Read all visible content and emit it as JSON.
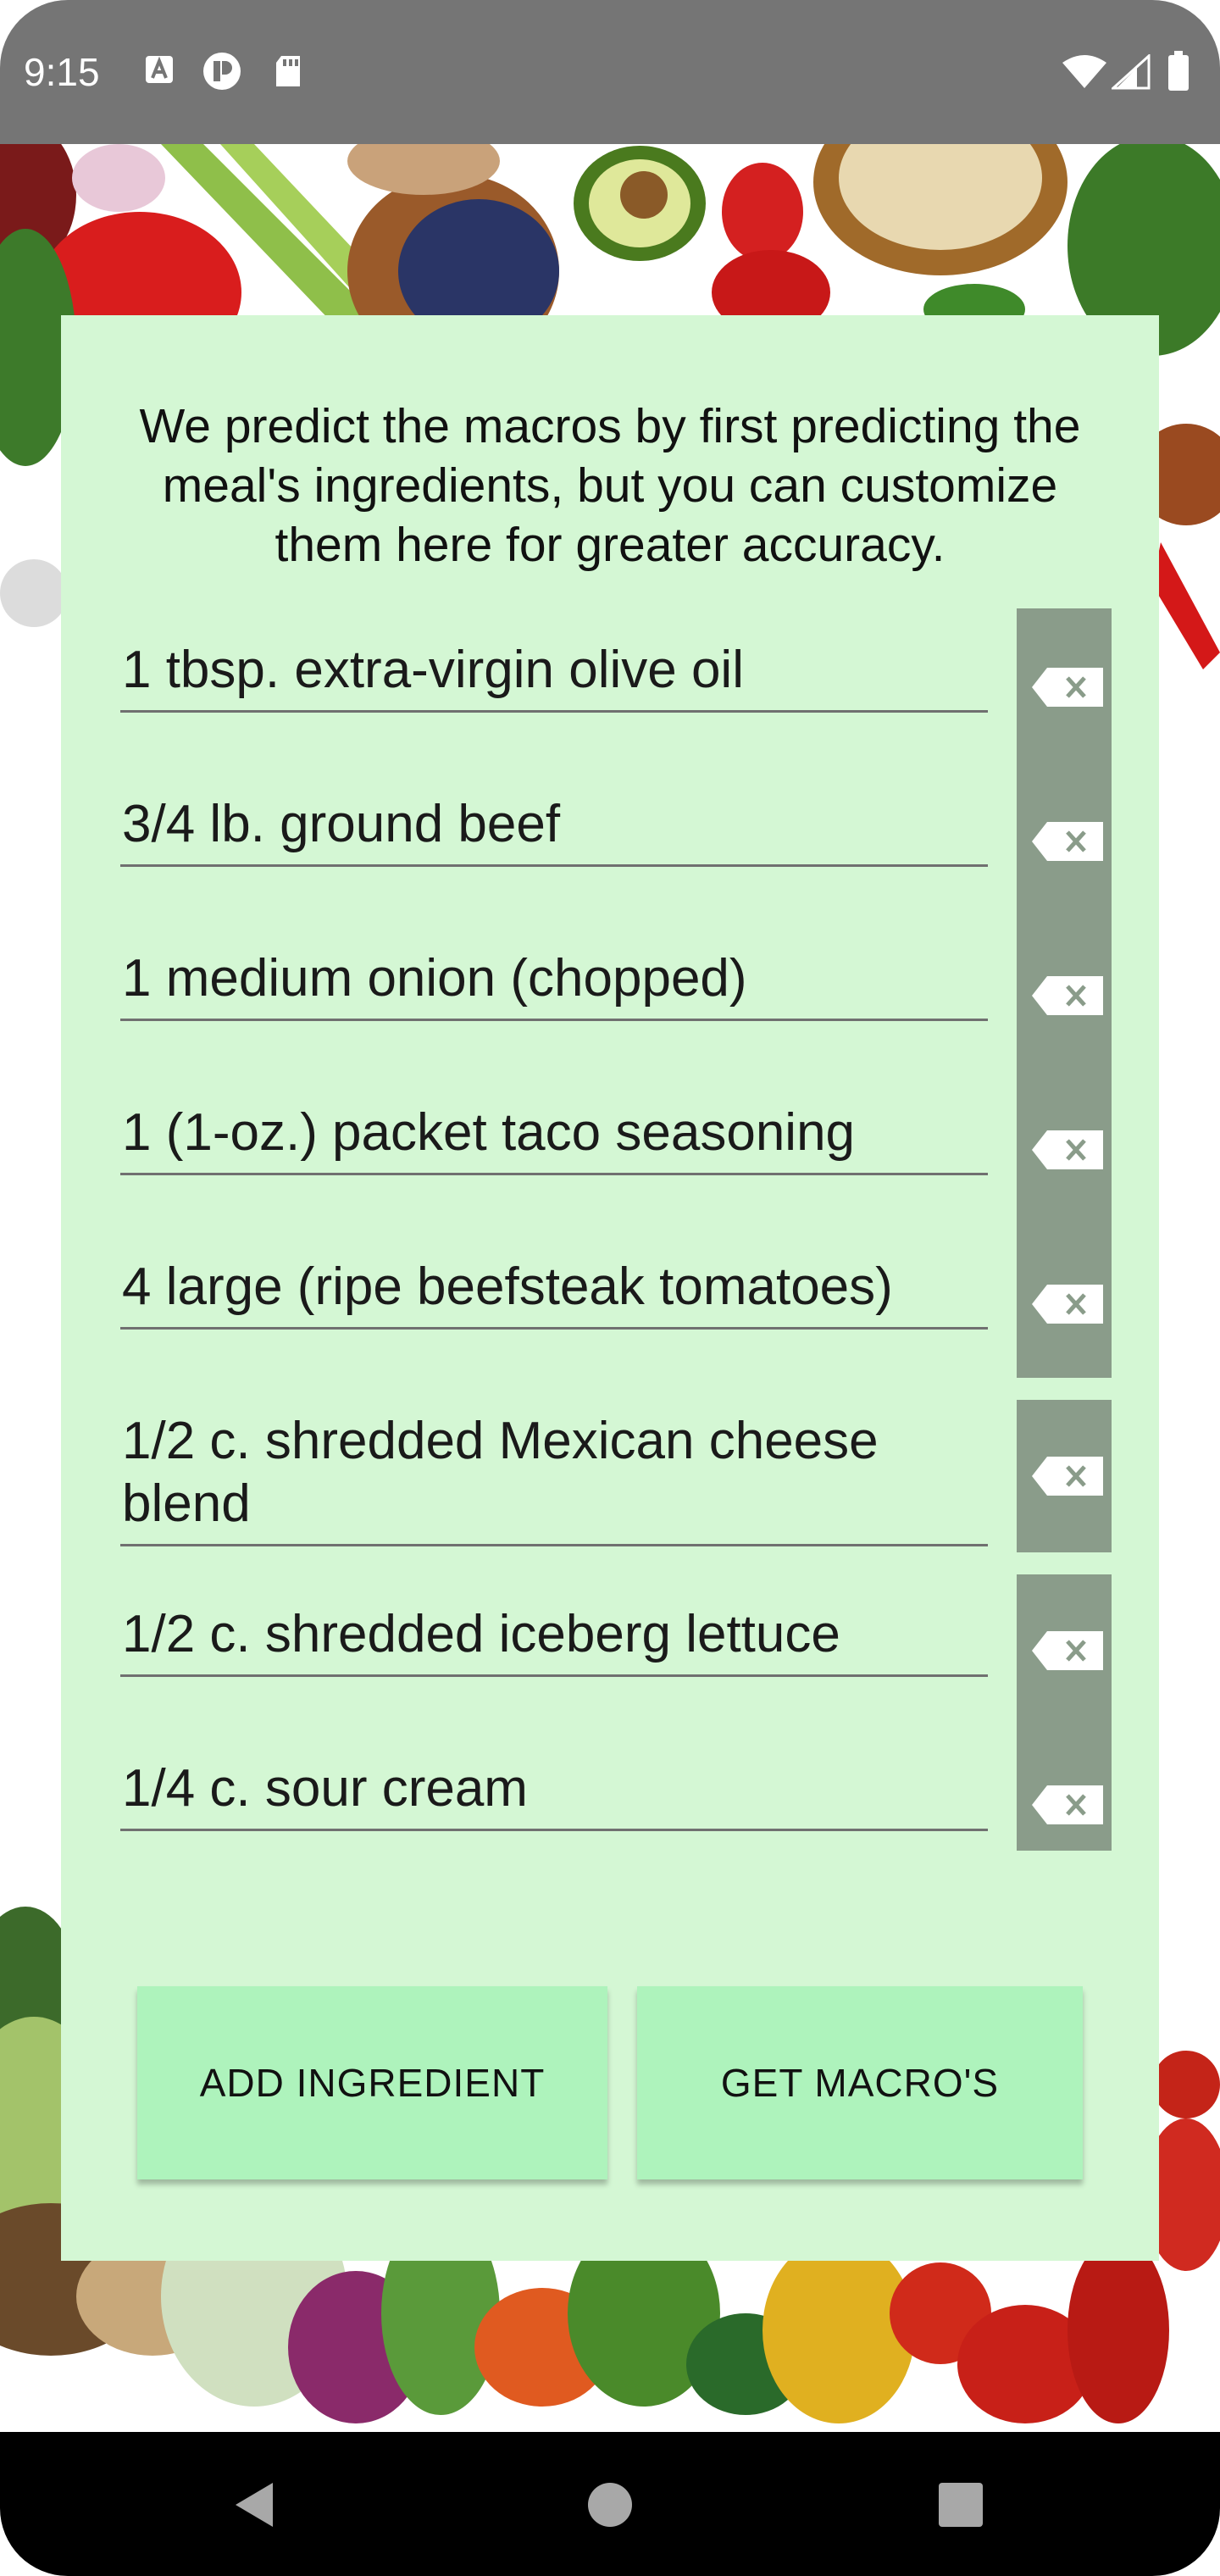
{
  "status_bar": {
    "time": "9:15"
  },
  "intro_text": "We predict the macros by first predicting the meal's ingredients, but you can customize them here for greater accuracy.",
  "ingredients": [
    "1 tbsp. extra-virgin olive oil",
    "3/4 lb. ground beef",
    "1 medium onion (chopped)",
    "1 (1-oz.) packet taco seasoning",
    "4 large (ripe beefsteak tomatoes)",
    "1/2 c. shredded Mexican cheese blend",
    "1/2 c. shredded iceberg lettuce",
    "1/4 c. sour cream"
  ],
  "buttons": {
    "add_ingredient": "ADD INGREDIENT",
    "get_macros": "GET MACRO'S"
  },
  "colors": {
    "card_background": "#d4f7d4",
    "button_background": "#aef3bc",
    "delete_column": "#8a9c8a"
  }
}
